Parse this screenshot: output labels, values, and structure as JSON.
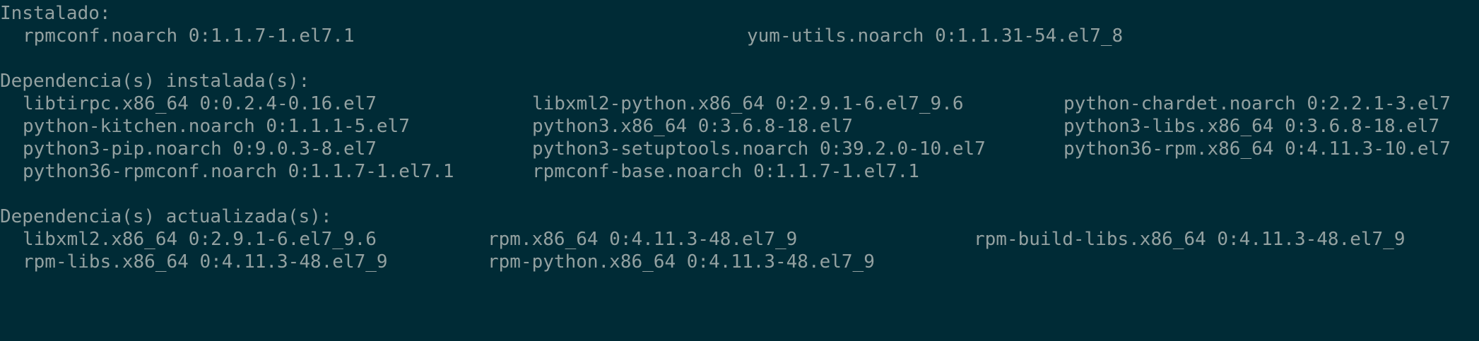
{
  "installed": {
    "heading": "Instalado:",
    "items": [
      "rpmconf.noarch 0:1.1.7-1.el7.1",
      "yum-utils.noarch 0:1.1.31-54.el7_8"
    ]
  },
  "deps_installed": {
    "heading": "Dependencia(s) instalada(s):",
    "rows": [
      [
        "libtirpc.x86_64 0:0.2.4-0.16.el7",
        "libxml2-python.x86_64 0:2.9.1-6.el7_9.6",
        "python-chardet.noarch 0:2.2.1-3.el7"
      ],
      [
        "python-kitchen.noarch 0:1.1.1-5.el7",
        "python3.x86_64 0:3.6.8-18.el7",
        "python3-libs.x86_64 0:3.6.8-18.el7"
      ],
      [
        "python3-pip.noarch 0:9.0.3-8.el7",
        "python3-setuptools.noarch 0:39.2.0-10.el7",
        "python36-rpm.x86_64 0:4.11.3-10.el7"
      ],
      [
        "python36-rpmconf.noarch 0:1.1.7-1.el7.1",
        "rpmconf-base.noarch 0:1.1.7-1.el7.1"
      ]
    ]
  },
  "deps_updated": {
    "heading": "Dependencia(s) actualizada(s):",
    "rows": [
      [
        "libxml2.x86_64 0:2.9.1-6.el7_9.6",
        "rpm.x86_64 0:4.11.3-48.el7_9",
        "rpm-build-libs.x86_64 0:4.11.3-48.el7_9"
      ],
      [
        "rpm-libs.x86_64 0:4.11.3-48.el7_9",
        "rpm-python.x86_64 0:4.11.3-48.el7_9"
      ]
    ]
  }
}
